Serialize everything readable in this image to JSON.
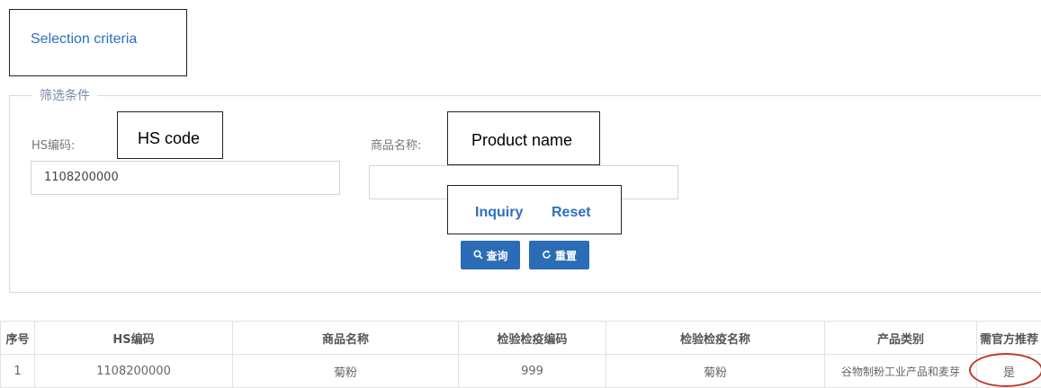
{
  "annotations": {
    "selection_criteria": "Selection criteria",
    "hs_code": "HS code",
    "product_name": "Product name",
    "inquiry": "Inquiry",
    "reset": "Reset"
  },
  "filter": {
    "legend": "筛选条件",
    "hs_label": "HS编码:",
    "hs_value": "1108200000",
    "name_label": "商品名称:",
    "name_value": "",
    "query_label": "查询",
    "reset_label": "重置",
    "query_icon": "search-icon",
    "reset_icon": "refresh-icon"
  },
  "table": {
    "headers": [
      "序号",
      "HS编码",
      "商品名称",
      "检验检疫编码",
      "检验检疫名称",
      "产品类别",
      "需官方推荐"
    ],
    "rows": [
      [
        "1",
        "1108200000",
        "菊粉",
        "999",
        "菊粉",
        "谷物制粉工业产品和麦芽",
        "是"
      ]
    ]
  },
  "colors": {
    "accent": "#2b6cb6",
    "annotation_text": "#2f6fbf",
    "highlight": "#c0392b"
  }
}
